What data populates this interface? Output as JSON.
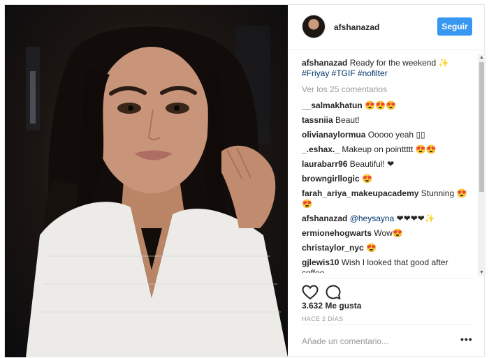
{
  "post": {
    "photo_icon": "portrait-photo",
    "header": {
      "username": "afshanazad",
      "follow_label": "Seguir"
    },
    "caption": {
      "username": "afshanazad",
      "text": "Ready for the weekend ✨",
      "hashtags": "#Friyay #TGIF #nofilter"
    },
    "load_more": "Ver los 25 comentarios",
    "comments": [
      {
        "user": "__salmakhatun",
        "text": "😍😍😍"
      },
      {
        "user": "tassniia",
        "text": "Beaut!"
      },
      {
        "user": "olivianaylormua",
        "text": "Ooooo yeah ▯▯"
      },
      {
        "user": "_.eshax._",
        "text": "Makeup on pointtttt 😍😍"
      },
      {
        "user": "laurabarr96",
        "text": "Beautiful! ❤"
      },
      {
        "user": "browngirllogic",
        "text": "😍"
      },
      {
        "user": "farah_ariya_makeupacademy",
        "text": "Stunning 😍 😍"
      },
      {
        "user": "afshanazad",
        "mention": "@heysayna",
        "text": "❤❤❤❤✨"
      },
      {
        "user": "ermionehogwarts",
        "text": "Wow😍"
      },
      {
        "user": "christaylor_nyc",
        "text": "😍"
      },
      {
        "user": "gjlewis10",
        "text": "Wish I looked that good after coffee."
      }
    ],
    "likes": "3.632 Me gusta",
    "time": "HACE 2 DÍAS",
    "comment_placeholder": "Añade un comentario...",
    "more_label": "•••",
    "icons": {
      "like": "heart-icon",
      "comment": "comment-bubble-icon",
      "more": "more-options-icon"
    },
    "colors": {
      "accent": "#3897f0",
      "hashtag": "#003569",
      "muted": "#999999"
    }
  }
}
